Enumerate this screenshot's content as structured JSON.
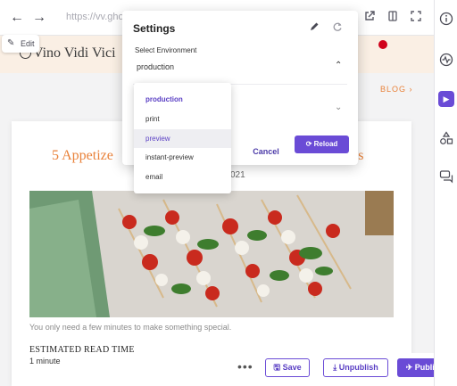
{
  "toolbar": {
    "url": "https://vv.ghos",
    "back_icon": "arrow-left-icon",
    "forward_icon": "arrow-right-icon",
    "open_icon": "external-link-icon",
    "device_icon": "device-icon",
    "fullscreen_icon": "expand-icon"
  },
  "edit_button": {
    "label": "Edit"
  },
  "site": {
    "title": "Vino Vidi Vici",
    "blog_link": "BLOG ›"
  },
  "post": {
    "title_start": "5 Appetize",
    "title_end": "ss",
    "date_fragment": "021",
    "caption": "You only need a few minutes to make something special.",
    "read_time_label": "ESTIMATED READ TIME",
    "read_time_value": "1 minute"
  },
  "settings": {
    "title": "Settings",
    "env_label": "Select Environment",
    "env_value": "production",
    "cancel_label": "Cancel",
    "reload_label": "Reload",
    "options": [
      "production",
      "print",
      "preview",
      "instant-preview",
      "email"
    ],
    "selected_option": "production",
    "hovered_option": "preview"
  },
  "actions": {
    "more_label": "•••",
    "save_label": "Save",
    "unpublish_label": "Unpublish",
    "publish_label": "Publish"
  },
  "rail": [
    "info-icon",
    "activity-icon",
    "play-icon",
    "shapes-icon",
    "comments-icon"
  ],
  "colors": {
    "accent": "#6a4bd6",
    "title_orange": "#e9823a",
    "header_bg": "#faefe4",
    "status_red": "#d0021b"
  }
}
